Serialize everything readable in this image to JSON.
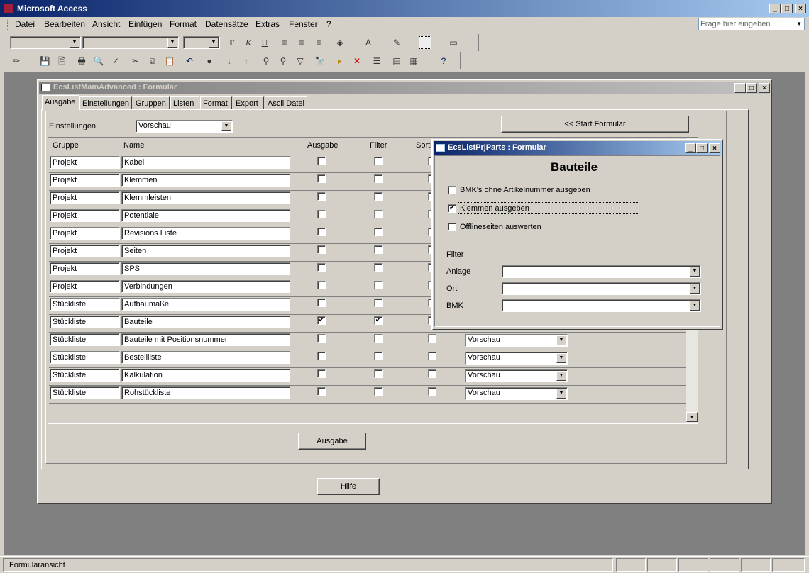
{
  "app": {
    "title": "Microsoft Access",
    "window_buttons": [
      "_",
      "□",
      "×"
    ]
  },
  "menu": [
    "Datei",
    "Bearbeiten",
    "Ansicht",
    "Einfügen",
    "Format",
    "Datensätze",
    "Extras",
    "Fenster",
    "?"
  ],
  "help_search": {
    "placeholder": "Frage hier eingeben"
  },
  "toolbar": {
    "bold": "F",
    "italic": "K",
    "underline": "U"
  },
  "main_form": {
    "title": "EcsListMainAdvanced : Formular",
    "tabs": [
      "Ausgabe",
      "Einstellungen",
      "Gruppen",
      "Listen",
      "Format",
      "Export",
      "Ascii Datei"
    ],
    "settings_label": "Einstellungen",
    "settings_value": "Vorschau",
    "start_button": "<< Start Formular",
    "columns": {
      "gruppe": "Gruppe",
      "name": "Name",
      "ausgabe": "Ausgabe",
      "filter": "Filter",
      "sort": "Sorti"
    },
    "rows": [
      {
        "gruppe": "Projekt",
        "name": "Kabel",
        "ausgabe": false,
        "filter": false
      },
      {
        "gruppe": "Projekt",
        "name": "Klemmen",
        "ausgabe": false,
        "filter": false
      },
      {
        "gruppe": "Projekt",
        "name": "Klemmleisten",
        "ausgabe": false,
        "filter": false
      },
      {
        "gruppe": "Projekt",
        "name": "Potentiale",
        "ausgabe": false,
        "filter": false
      },
      {
        "gruppe": "Projekt",
        "name": "Revisions Liste",
        "ausgabe": false,
        "filter": false
      },
      {
        "gruppe": "Projekt",
        "name": "Seiten",
        "ausgabe": false,
        "filter": false
      },
      {
        "gruppe": "Projekt",
        "name": "SPS",
        "ausgabe": false,
        "filter": false
      },
      {
        "gruppe": "Projekt",
        "name": "Verbindungen",
        "ausgabe": false,
        "filter": false
      },
      {
        "gruppe": "Stückliste",
        "name": "Aufbaumaße",
        "ausgabe": false,
        "filter": false
      },
      {
        "gruppe": "Stückliste",
        "name": "Bauteile",
        "ausgabe": true,
        "filter": true
      },
      {
        "gruppe": "Stückliste",
        "name": "Bauteile mit Positionsnummer",
        "ausgabe": false,
        "filter": false,
        "mode": "Vorschau"
      },
      {
        "gruppe": "Stückliste",
        "name": "Bestellliste",
        "ausgabe": false,
        "filter": false,
        "mode": "Vorschau"
      },
      {
        "gruppe": "Stückliste",
        "name": "Kalkulation",
        "ausgabe": false,
        "filter": false,
        "mode": "Vorschau"
      },
      {
        "gruppe": "Stückliste",
        "name": "Rohstückliste",
        "ausgabe": false,
        "filter": false,
        "mode": "Vorschau"
      }
    ],
    "output_button": "Ausgabe",
    "help_button": "Hilfe"
  },
  "parts_form": {
    "title": "EcsListPrjParts : Formular",
    "heading": "Bauteile",
    "options": [
      {
        "label": "BMK's ohne Artikelnummer ausgeben",
        "checked": false
      },
      {
        "label": "Klemmen ausgeben",
        "checked": true
      },
      {
        "label": "Offlineseiten auswerten",
        "checked": false
      }
    ],
    "filter_label": "Filter",
    "filters": [
      {
        "label": "Anlage",
        "value": ""
      },
      {
        "label": "Ort",
        "value": ""
      },
      {
        "label": "BMK",
        "value": ""
      }
    ]
  },
  "statusbar": {
    "text": "Formularansicht"
  },
  "colors": {
    "titlebar": "#0a246a",
    "face": "#d4d0c8",
    "workspace": "#808080"
  }
}
